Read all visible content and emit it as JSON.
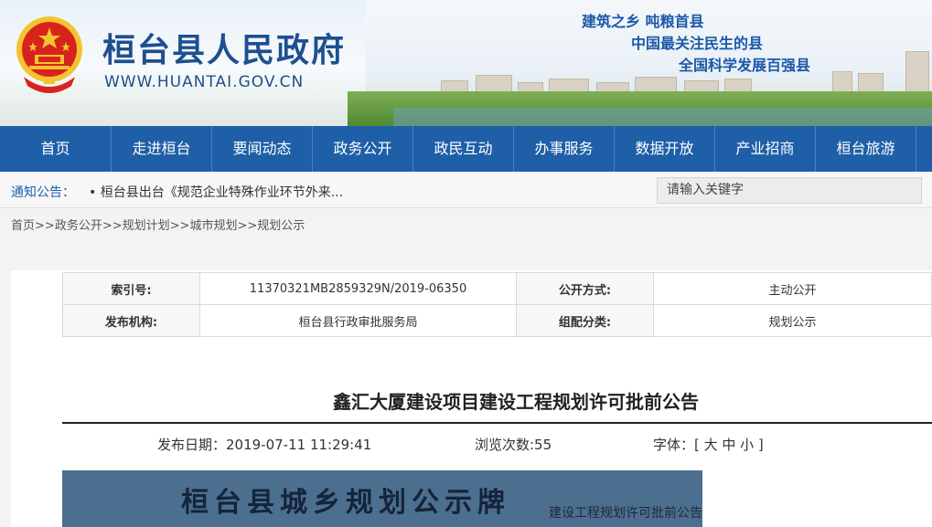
{
  "header": {
    "site_title": "桓台县人民政府",
    "site_url": "WWW.HUANTAI.GOV.CN",
    "slogans": [
      "建筑之乡 吨粮首县",
      "中国最关注民生的县",
      "全国科学发展百强县"
    ]
  },
  "nav": {
    "items": [
      "首页",
      "走进桓台",
      "要闻动态",
      "政务公开",
      "政民互动",
      "办事服务",
      "数据开放",
      "产业招商",
      "桓台旅游"
    ]
  },
  "notice": {
    "label": "通知公告：",
    "text": "• 桓台县出台《规范企业特殊作业环节外来..."
  },
  "search": {
    "placeholder": "请输入关键字"
  },
  "breadcrumb": [
    "首页",
    ">>",
    "政务公开",
    ">>",
    "规划计划",
    ">>",
    "城市规划",
    ">>",
    "规划公示"
  ],
  "meta": {
    "index_label": "索引号:",
    "index_value": "11370321MB2859329N/2019-06350",
    "mode_label": "公开方式:",
    "mode_value": "主动公开",
    "org_label": "发布机构:",
    "org_value": "桓台县行政审批服务局",
    "cat_label": "组配分类:",
    "cat_value": "规划公示"
  },
  "article": {
    "title": "鑫汇大厦建设项目建设工程规划许可批前公告",
    "date": "发布日期：2019-07-11 11:29:41",
    "views": "浏览次数:55",
    "font_label": "字体：[ 大 中 小 ]"
  },
  "image_sign": {
    "title": "桓台县城乡规划公示牌",
    "subtitle": "建设工程规划许可批前公告"
  },
  "colors": {
    "nav_bg": "#1f5fa7",
    "title_blue": "#1e4f8f",
    "emblem_red": "#d8231c",
    "emblem_gold": "#f4c430"
  }
}
